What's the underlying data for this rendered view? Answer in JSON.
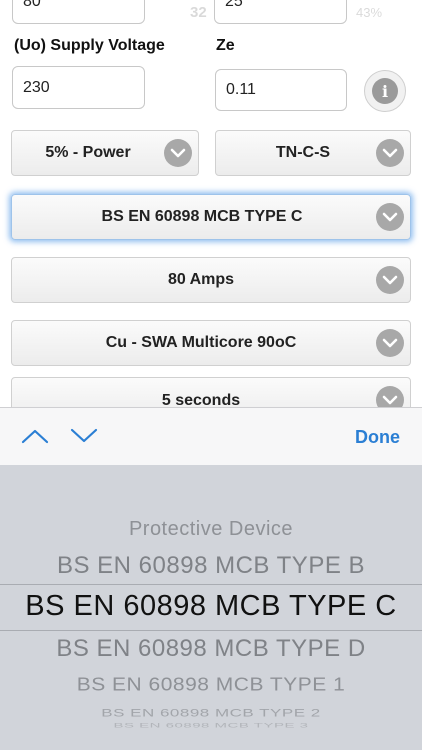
{
  "fields": {
    "top_left_value": "80",
    "top_right_value": "25",
    "supply_voltage_label": "(Uo) Supply Voltage",
    "supply_voltage_value": "230",
    "ze_label": "Ze",
    "ze_value": "0.11"
  },
  "status_bar": {
    "time_fragment": "32",
    "battery_fragment": "43%"
  },
  "selects": {
    "voltage_drop": "5% - Power",
    "earthing_system": "TN-C-S",
    "protective_device": "BS EN 60898 MCB TYPE C",
    "rating": "80 Amps",
    "cable_type": "Cu - SWA Multicore 90oC",
    "disconnection_time": "5 seconds"
  },
  "toolbar": {
    "done_label": "Done"
  },
  "picker": {
    "header": "Protective Device",
    "options": [
      "BS EN 60898 MCB TYPE B",
      "BS EN 60898 MCB TYPE C",
      "BS EN 60898 MCB TYPE D",
      "BS EN 60898 MCB TYPE 1",
      "BS EN 60898 MCB TYPE 2",
      "BS EN 60898 MCB TYPE 3"
    ],
    "selected": "BS EN 60898 MCB TYPE C"
  },
  "colors": {
    "accent": "#2b7fd4",
    "focus_glow": "#6eaaeb",
    "picker_bg": "#d1d4da",
    "chevron_bg": "#a8a8a8"
  },
  "icons": {
    "info": "info-icon",
    "chevron": "chevron-down-icon",
    "prev": "chevron-up-icon",
    "next": "chevron-down-icon"
  }
}
